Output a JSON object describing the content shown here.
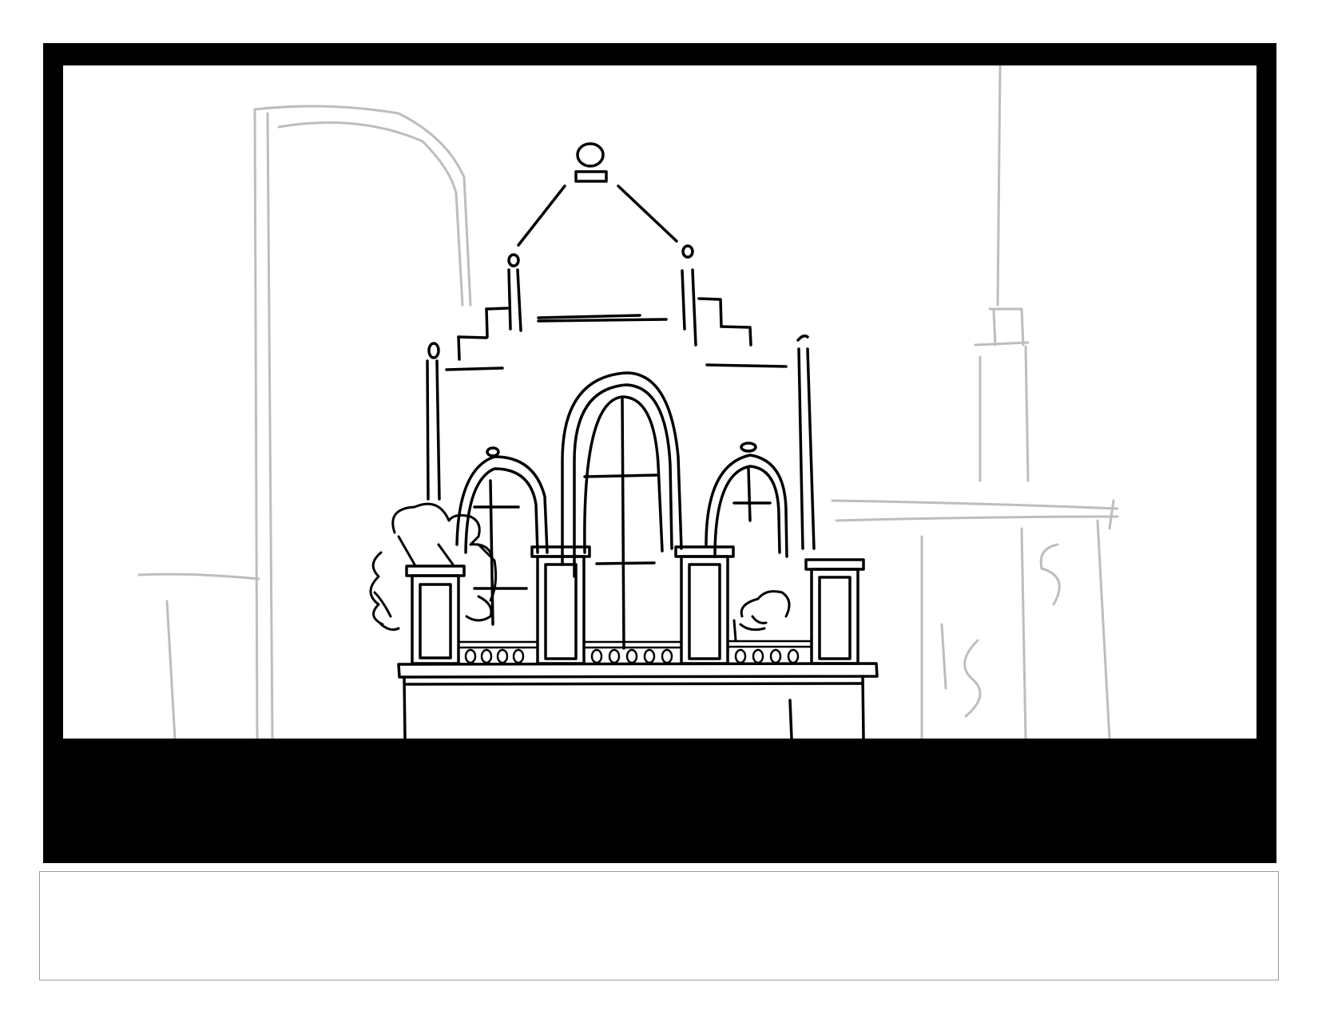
{
  "storyboard": {
    "panel": {
      "frame_color": "#000000",
      "background_color": "#ffffff",
      "line_color_sketch": "#bdbdbd",
      "line_color_ink": "#000000",
      "scene": "building-facade-sketch"
    },
    "caption": {
      "text": "",
      "border_color": "#9a9a9a"
    }
  }
}
